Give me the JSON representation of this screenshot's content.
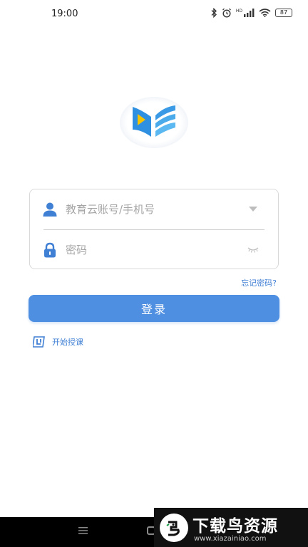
{
  "status_bar": {
    "time": "19:00",
    "icons": [
      "bluetooth-icon",
      "alarm-icon",
      "signal-icon",
      "wifi-icon",
      "battery-icon"
    ],
    "signal_tag": "HD",
    "battery_level": "87"
  },
  "logo": {
    "icon": "education-book-logo-icon"
  },
  "login_form": {
    "account_placeholder": "教育云账号/手机号",
    "password_placeholder": "密码",
    "account_value": "",
    "password_value": ""
  },
  "links": {
    "forgot_password": "忘记密码?"
  },
  "buttons": {
    "login": "登录"
  },
  "start_teaching": {
    "label": "开始授课"
  },
  "watermark": {
    "title": "下载鸟资源",
    "url": "www.xiazainiao.com"
  },
  "colors": {
    "accent": "#4e8fe2",
    "link": "#3f7fd4",
    "logo_blue": "#2f8fe0",
    "logo_light": "#5bb8f0",
    "logo_yellow": "#f5c300"
  }
}
